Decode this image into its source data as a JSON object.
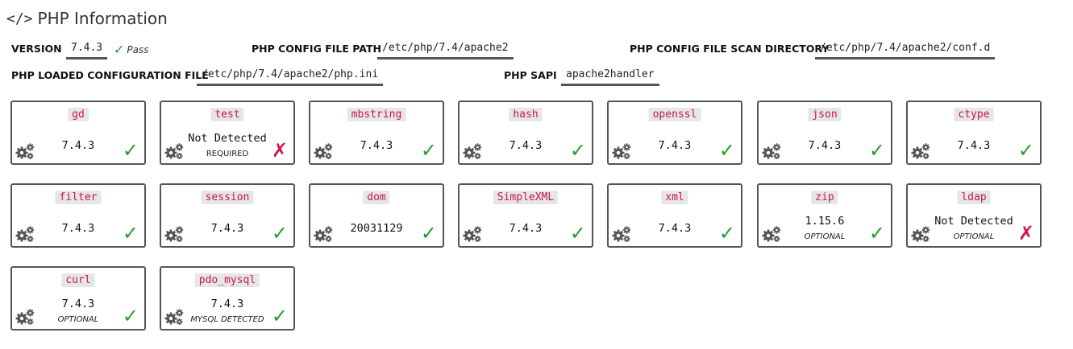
{
  "header": {
    "title": "PHP Information",
    "icon": "code-icon"
  },
  "info": {
    "version_label": "VERSION",
    "version_value": "7.4.3",
    "version_status": "Pass",
    "config_path_label": "PHP CONFIG FILE PATH",
    "config_path_value": "/etc/php/7.4/apache2",
    "scan_dir_label": "PHP CONFIG FILE SCAN DIRECTORY",
    "scan_dir_value": "/etc/php/7.4/apache2/conf.d",
    "loaded_config_label": "PHP LOADED CONFIGURATION FILE",
    "loaded_config_value": "/etc/php/7.4/apache2/php.ini",
    "sapi_label": "PHP SAPI",
    "sapi_value": "apache2handler"
  },
  "colors": {
    "ok": "#2a9a2a",
    "fail": "#d4144d",
    "ext_name": "#c8174f"
  },
  "extensions": [
    {
      "name": "gd",
      "version": "7.4.3",
      "note": "",
      "status": "ok"
    },
    {
      "name": "test",
      "version": "Not Detected",
      "note": "REQUIRED",
      "status": "fail"
    },
    {
      "name": "mbstring",
      "version": "7.4.3",
      "note": "",
      "status": "ok"
    },
    {
      "name": "hash",
      "version": "7.4.3",
      "note": "",
      "status": "ok"
    },
    {
      "name": "openssl",
      "version": "7.4.3",
      "note": "",
      "status": "ok"
    },
    {
      "name": "json",
      "version": "7.4.3",
      "note": "",
      "status": "ok"
    },
    {
      "name": "ctype",
      "version": "7.4.3",
      "note": "",
      "status": "ok"
    },
    {
      "name": "filter",
      "version": "7.4.3",
      "note": "",
      "status": "ok"
    },
    {
      "name": "session",
      "version": "7.4.3",
      "note": "",
      "status": "ok"
    },
    {
      "name": "dom",
      "version": "20031129",
      "note": "",
      "status": "ok"
    },
    {
      "name": "SimpleXML",
      "version": "7.4.3",
      "note": "",
      "status": "ok"
    },
    {
      "name": "xml",
      "version": "7.4.3",
      "note": "",
      "status": "ok"
    },
    {
      "name": "zip",
      "version": "1.15.6",
      "note": "OPTIONAL",
      "status": "ok"
    },
    {
      "name": "ldap",
      "version": "Not Detected",
      "note": "OPTIONAL",
      "status": "fail"
    },
    {
      "name": "curl",
      "version": "7.4.3",
      "note": "OPTIONAL",
      "status": "ok"
    },
    {
      "name": "pdo_mysql",
      "version": "7.4.3",
      "note": "MYSQL DETECTED",
      "status": "ok"
    }
  ]
}
